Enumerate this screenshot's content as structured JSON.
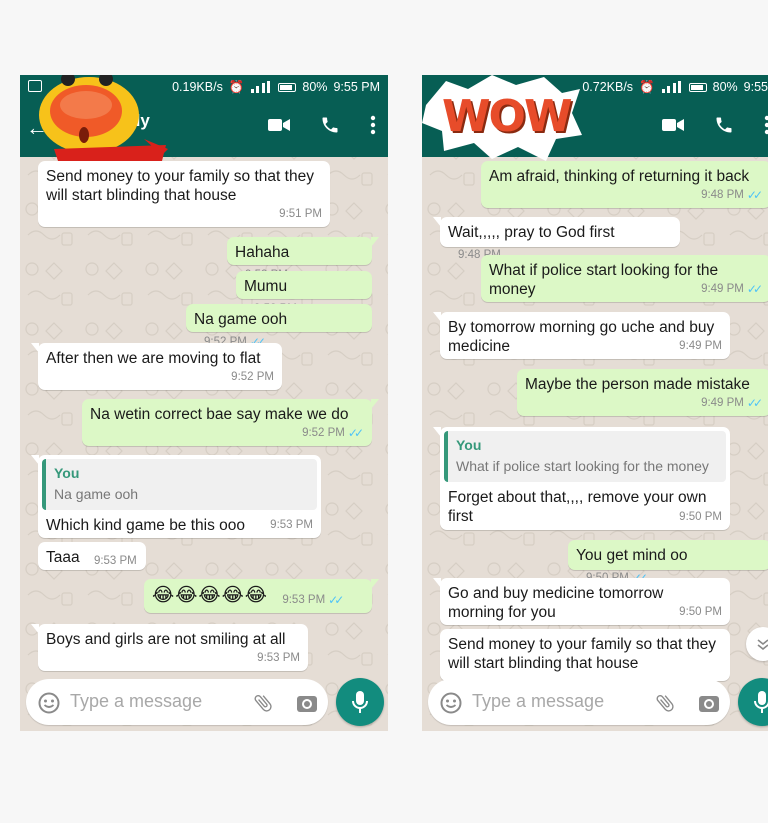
{
  "left": {
    "status": {
      "speed": "0.19KB/s",
      "battery": "80%",
      "time": "9:55 PM"
    },
    "contact_name": "dy",
    "messages": [
      {
        "dir": "in",
        "text": "Send money to your family so that they will start blinding that house",
        "time": "9:51 PM"
      },
      {
        "dir": "out",
        "text": "Hahaha",
        "time": "9:52 PM"
      },
      {
        "dir": "out",
        "text": "Mumu",
        "time": "9:52 PM"
      },
      {
        "dir": "out",
        "text": "Na game ooh",
        "time": "9:52 PM"
      },
      {
        "dir": "in",
        "text": "After then we are moving to flat",
        "time": "9:52 PM"
      },
      {
        "dir": "out",
        "text": "Na wetin correct bae say make we do",
        "time": "9:52 PM"
      },
      {
        "dir": "in",
        "quote_author": "You",
        "quote_text": "Na game ooh",
        "text": "Which kind game be this ooo",
        "time": "9:53 PM"
      },
      {
        "dir": "in",
        "text": "Taaa",
        "time": "9:53 PM"
      },
      {
        "dir": "out",
        "text": "😂😂😂😂😂",
        "time": "9:53 PM"
      },
      {
        "dir": "in",
        "text": "Boys and girls are not smiling at all",
        "time": "9:53 PM"
      }
    ],
    "input_placeholder": "Type a message"
  },
  "right": {
    "status": {
      "speed": "0.72KB/s",
      "battery": "80%",
      "time": "9:55"
    },
    "sticker_text": "WOW",
    "messages": [
      {
        "dir": "out",
        "text": "Am afraid, thinking of returning it back",
        "time": "9:48 PM"
      },
      {
        "dir": "in",
        "text": "Wait,,,,, pray to God first",
        "time": "9:48 PM"
      },
      {
        "dir": "out",
        "text": "What if police start looking for the money",
        "time": "9:49 PM"
      },
      {
        "dir": "in",
        "text": "By tomorrow morning go uche and buy medicine",
        "time": "9:49 PM"
      },
      {
        "dir": "out",
        "text": "Maybe the person made mistake",
        "time": "9:49 PM"
      },
      {
        "dir": "in",
        "quote_author": "You",
        "quote_text": "What if police start looking for the money",
        "text": "Forget about that,,,, remove your own first",
        "time": "9:50 PM"
      },
      {
        "dir": "out",
        "text": "You get mind oo",
        "time": "9:50 PM"
      },
      {
        "dir": "in",
        "text": "Go and buy medicine tomorrow morning for you",
        "time": "9:50 PM"
      },
      {
        "dir": "in",
        "text": "Send money to your family so that they will start blinding that house",
        "time": ""
      }
    ],
    "input_placeholder": "Type a message"
  },
  "colors": {
    "header": "#075e54",
    "outgoing": "#dcf8c6",
    "incoming": "#ffffff",
    "mic": "#128c7e",
    "ticks": "#4fc3f7"
  },
  "icons": [
    "image-icon",
    "alarm-icon",
    "signal-icon",
    "battery-icon",
    "back-arrow-icon",
    "video-call-icon",
    "phone-icon",
    "more-vert-icon",
    "emoji-icon",
    "attach-icon",
    "camera-icon",
    "mic-icon",
    "chevron-down-icon"
  ]
}
